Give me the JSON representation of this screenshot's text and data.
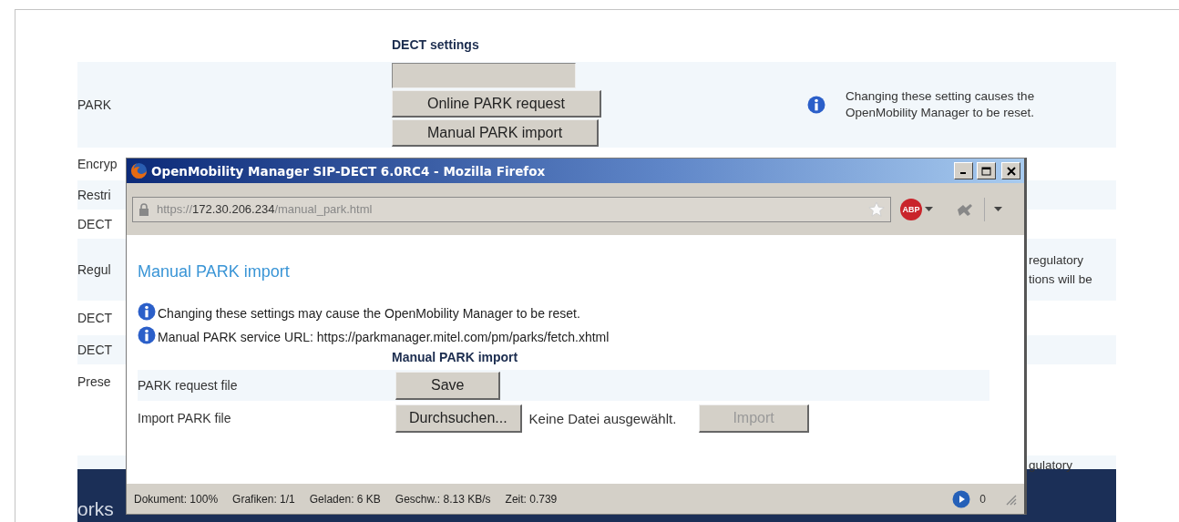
{
  "page": {
    "section_title": "DECT settings",
    "park": {
      "label": "PARK",
      "buttons": [
        "Online PARK request",
        "Manual PARK import"
      ],
      "note": "Changing these setting causes the OpenMobility Manager to be reset."
    },
    "rows": [
      {
        "label": "Encryp"
      },
      {
        "label": "Restri"
      },
      {
        "label": "DECT"
      },
      {
        "label": "Regul",
        "note_lines": [
          "regulatory",
          "tions will be"
        ]
      },
      {
        "label": "DECT"
      },
      {
        "label": "DECT"
      },
      {
        "label": "Prese"
      },
      {
        "note_lines": [
          "gulatory"
        ]
      }
    ],
    "footer": "orks"
  },
  "popup": {
    "title": "OpenMobility Manager SIP-DECT 6.0RC4 - Mozilla Firefox",
    "url_scheme": "https://",
    "url_host": "172.30.206.234",
    "url_path": "/manual_park.html",
    "addon_badge": "ABP",
    "heading": "Manual PARK import",
    "notes": [
      "Changing these settings may cause the OpenMobility Manager to be reset.",
      "Manual PARK service URL: https://parkmanager.mitel.com/pm/parks/fetch.xhtml"
    ],
    "table_title": "Manual PARK import",
    "rows": [
      {
        "label": "PARK request file",
        "buttons": [
          {
            "label": "Save",
            "disabled": false
          }
        ]
      },
      {
        "label": "Import PARK file",
        "buttons": [
          {
            "label": "Durchsuchen...",
            "disabled": false
          }
        ],
        "file_status": "Keine Datei ausgewählt.",
        "action": {
          "label": "Import",
          "disabled": true
        }
      }
    ],
    "status": [
      "Dokument: 100%",
      "Grafiken: 1/1",
      "Geladen: 6 KB",
      "Geschw.: 8.13 KB/s",
      "Zeit: 0.739"
    ],
    "status_count": "0"
  }
}
